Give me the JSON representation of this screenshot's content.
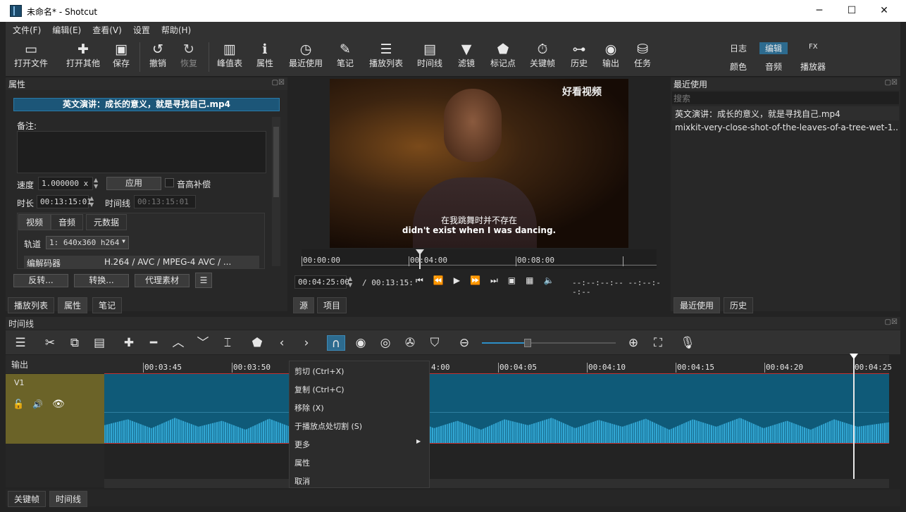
{
  "window": {
    "title": "未命名* - Shotcut"
  },
  "menu": [
    "文件(F)",
    "编辑(E)",
    "查看(V)",
    "设置",
    "帮助(H)"
  ],
  "toolbar": [
    {
      "label": "打开文件",
      "icon": "open-folder-icon"
    },
    {
      "label": "打开其他",
      "icon": "open-other-icon"
    },
    {
      "label": "保存",
      "icon": "save-icon"
    },
    {
      "label": "撤销",
      "icon": "undo-icon"
    },
    {
      "label": "恢复",
      "icon": "redo-icon"
    },
    {
      "label": "峰值表",
      "icon": "peak-meter-icon"
    },
    {
      "label": "属性",
      "icon": "properties-icon"
    },
    {
      "label": "最近使用",
      "icon": "recent-clock-icon"
    },
    {
      "label": "笔记",
      "icon": "notes-icon"
    },
    {
      "label": "播放列表",
      "icon": "playlist-icon"
    },
    {
      "label": "时间线",
      "icon": "timeline-icon"
    },
    {
      "label": "滤镜",
      "icon": "filter-icon"
    },
    {
      "label": "标记点",
      "icon": "marker-icon"
    },
    {
      "label": "关键帧",
      "icon": "keyframes-icon"
    },
    {
      "label": "历史",
      "icon": "history-icon"
    },
    {
      "label": "输出",
      "icon": "export-icon"
    },
    {
      "label": "任务",
      "icon": "jobs-icon"
    }
  ],
  "layouts": {
    "row1": [
      "日志",
      "编辑",
      "FX"
    ],
    "row2": [
      "颜色",
      "音频",
      "播放器"
    ],
    "selected": "编辑"
  },
  "properties": {
    "panel_title": "属性",
    "clip_name": "英文演讲：成长的意义，就是寻找自己.mp4",
    "note_label": "备注:",
    "speed_label": "速度",
    "speed_value": "1.000000 x",
    "apply_label": "应用",
    "pitch_label": "音高补偿",
    "duration_label": "时长",
    "duration_value": "00:13:15:01",
    "timeline_label": "时间线",
    "timeline_value": "00:13:15:01",
    "tabs": [
      "视频",
      "音频",
      "元数据"
    ],
    "track_label": "轨道",
    "track_value": "1: 640x360 h264",
    "codec_label": "编解码器",
    "codec_value": "H.264 / AVC / MPEG-4 AVC / ...",
    "buttons": [
      "反转...",
      "转换...",
      "代理素材"
    ]
  },
  "left_bottom_tabs": [
    "播放列表",
    "属性",
    "笔记"
  ],
  "player": {
    "logo_text": "好看视频",
    "subtitle_cn": "在我跳舞时并不存在",
    "subtitle_en": "didn't exist when I was dancing.",
    "scrub_labels": [
      "00:00:00",
      "00:04:00",
      "00:08:00"
    ],
    "position": "00:04:25:00",
    "duration": "/ 00:13:15:",
    "in_out": "--:--:--:-- --:--:--:--",
    "tabs": [
      "源",
      "项目"
    ]
  },
  "recent": {
    "panel_title": "最近使用",
    "search_placeholder": "搜索",
    "items": [
      "英文演讲：成长的意义，就是寻找自己.mp4",
      "mixkit-very-close-shot-of-the-leaves-of-a-tree-wet-1..."
    ],
    "tabs": [
      "最近使用",
      "历史"
    ]
  },
  "timeline": {
    "panel_title": "时间线",
    "output_label": "输出",
    "track_name": "V1",
    "ruler": [
      "00:03:45",
      "00:03:50",
      "00:04:00",
      "00:04:05",
      "00:04:10",
      "00:04:15",
      "00:04:20",
      "00:04:25"
    ],
    "ruler_partial": "4:00",
    "context_menu": [
      "剪切 (Ctrl+X)",
      "复制 (Ctrl+C)",
      "移除 (X)",
      "于播放点处切割 (S)",
      "更多",
      "属性",
      "取消"
    ]
  },
  "bottom_tabs": [
    "关键帧",
    "时间线"
  ]
}
